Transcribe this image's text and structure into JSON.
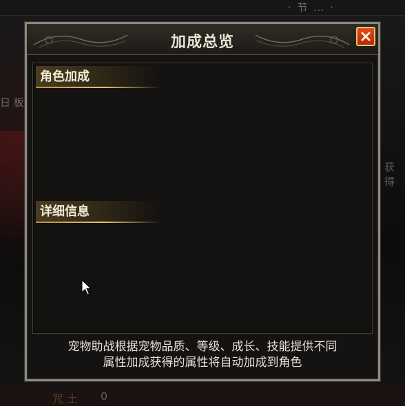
{
  "background": {
    "top_text": "· 节 … ·",
    "left_text": "日 板",
    "right_text": "获 得",
    "bottom_text": "咒 土",
    "bottom_value": "0"
  },
  "modal": {
    "title": "加成总览",
    "close_icon": "close-x-icon",
    "sections": [
      {
        "label": "角色加成"
      },
      {
        "label": "详细信息"
      }
    ],
    "footer_lines": [
      "宠物助战根据宠物品质、等级、成长、技能提供不同",
      "属性加成获得的属性将自动加成到角色"
    ]
  },
  "colors": {
    "frame": "#8c877c",
    "panel_bg": "#131211",
    "title_text": "#e8e3d4",
    "section_gold": "#e8c270",
    "close_red": "#d73a15"
  }
}
